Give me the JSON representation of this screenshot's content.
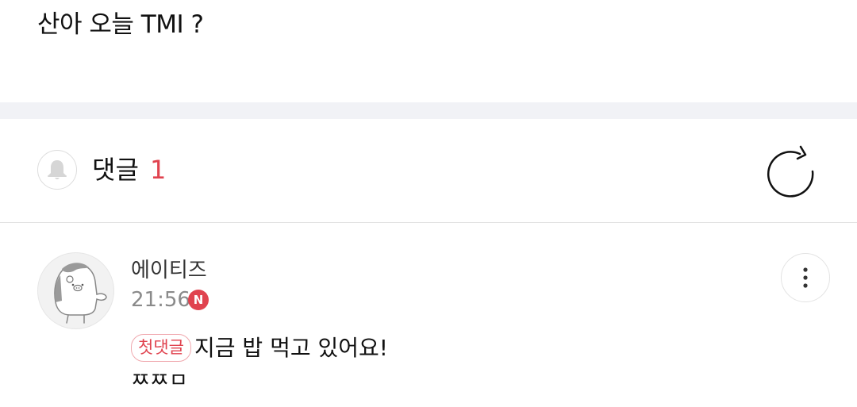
{
  "post": {
    "title": "산아 오늘 TMI ?"
  },
  "comments_header": {
    "title": "댓글",
    "count": "1",
    "bell_icon": "bell-icon",
    "refresh_icon": "refresh-icon",
    "accent_color": "#e0434f"
  },
  "comments": [
    {
      "author": "에이티즈",
      "time": "21:56",
      "new_badge": "N",
      "first_badge": "첫댓글",
      "text": "지금 밥 먹고 있어요!",
      "text_line2": "ㅉㅉㅁ",
      "more_icon": "more-vertical-icon",
      "avatar": "avatar-character"
    }
  ]
}
